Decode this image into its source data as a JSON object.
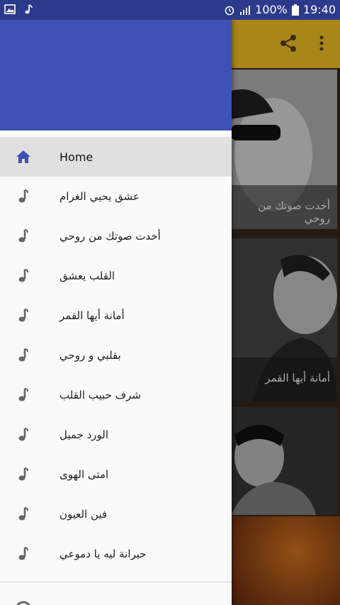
{
  "status_bar": {
    "battery_percent": "100%",
    "time": "19:40",
    "left_icons": [
      "image-icon",
      "music-note-icon"
    ],
    "right_icons": [
      "alarm-icon",
      "signal-icon",
      "battery-icon"
    ]
  },
  "app_bar": {
    "background": "#a8861a",
    "actions": [
      "share-icon",
      "more-vert-icon"
    ]
  },
  "cards": [
    {
      "caption": "أخدت صوتك من روحي"
    },
    {
      "caption": "أمانة أيها القمر"
    },
    {
      "caption": ""
    }
  ],
  "drawer": {
    "header_color": "#3f51b5",
    "items": [
      {
        "label": "Home",
        "icon": "home-icon",
        "active": true
      },
      {
        "label": "عشق يحيي الغرام",
        "icon": "music-note-icon"
      },
      {
        "label": "أخدت صوتك من روحي",
        "icon": "music-note-icon"
      },
      {
        "label": "القلب يعشق",
        "icon": "music-note-icon"
      },
      {
        "label": "أمانة أيها القمر",
        "icon": "music-note-icon"
      },
      {
        "label": "بقلبي و روحي",
        "icon": "music-note-icon"
      },
      {
        "label": "شرف حبيب القلب",
        "icon": "music-note-icon"
      },
      {
        "label": "الورد جميل",
        "icon": "music-note-icon"
      },
      {
        "label": "امتى الهوى",
        "icon": "music-note-icon"
      },
      {
        "label": "فين العيون",
        "icon": "music-note-icon"
      },
      {
        "label": "حيرانة ليه يا دموعي",
        "icon": "music-note-icon"
      }
    ]
  }
}
